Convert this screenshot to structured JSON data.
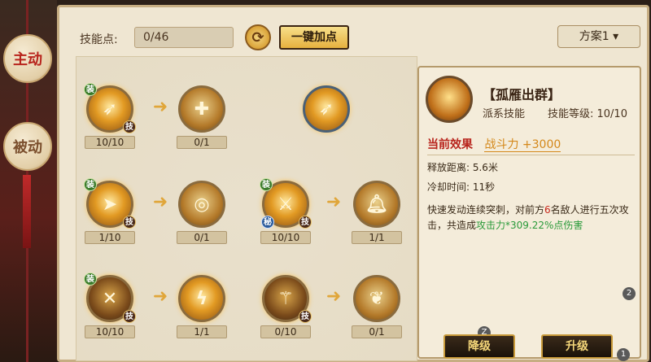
{
  "tabs": {
    "active": "主动",
    "inactive": "被动"
  },
  "toolbar": {
    "skill_points_label": "技能点:",
    "skill_points_value": "0/46",
    "auto_add_label": "一键加点",
    "scheme_label": "方案1 ▾"
  },
  "tree": {
    "nodes": [
      {
        "level": "10/10",
        "zhuang": "装",
        "ji": "技"
      },
      {
        "level": "0/1"
      },
      {
        "level": ""
      },
      {
        "level": "1/10",
        "zhuang": "装",
        "ji": "技"
      },
      {
        "level": "0/1"
      },
      {
        "level": "10/10",
        "zhuang": "装",
        "ji": "技",
        "mi": "秘"
      },
      {
        "level": "1/1"
      },
      {
        "level": "10/10",
        "zhuang": "装",
        "ji": "技"
      },
      {
        "level": "1/1"
      },
      {
        "level": "0/10",
        "ji": "技"
      },
      {
        "level": "0/1"
      }
    ]
  },
  "detail": {
    "title": "【孤雁出群】",
    "type": "派系技能",
    "level_label": "技能等级: 10/10",
    "effect_label": "当前效果",
    "effect_value": "战斗力 +3000",
    "range": "释放距离: 5.6米",
    "cooldown": "冷却时间: 11秒",
    "desc_1": "快速发动连续突刺，对前方",
    "desc_red": "6",
    "desc_2": "名敌人进行五次攻击，共造成",
    "desc_green": "攻击力*309.22%点伤害",
    "btn_down": "降级",
    "btn_up": "升级"
  },
  "badges": {
    "b1": "2",
    "b2": "Z",
    "b3": "1"
  }
}
